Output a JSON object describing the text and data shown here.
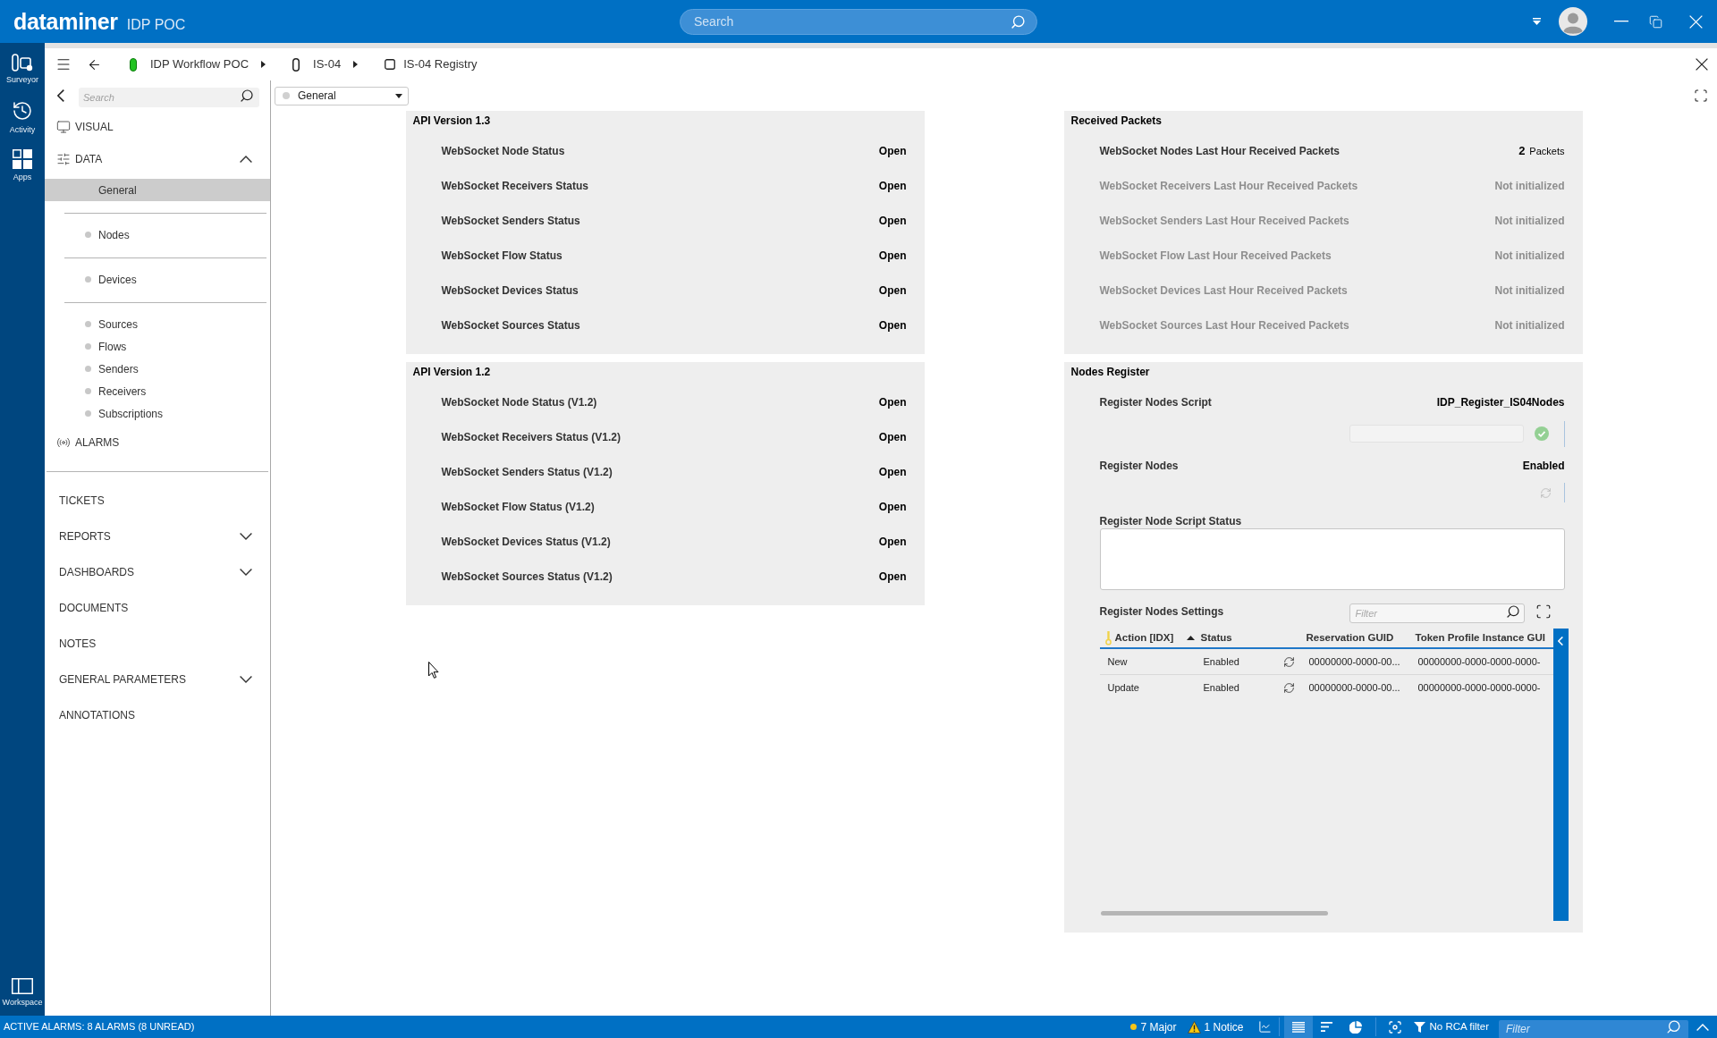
{
  "app": {
    "title": "dataminer",
    "subtitle": "IDP POC"
  },
  "header_search": {
    "placeholder": "Search"
  },
  "rail": {
    "items": [
      {
        "label": "Surveyor"
      },
      {
        "label": "Activity"
      },
      {
        "label": "Apps"
      }
    ],
    "bottom": {
      "label": "Workspace"
    }
  },
  "breadcrumb": [
    {
      "kind": "element",
      "label": "IDP Workflow POC"
    },
    {
      "kind": "protocol",
      "label": "IS-04"
    },
    {
      "kind": "page",
      "label": "IS-04 Registry"
    }
  ],
  "nav": {
    "search": {
      "placeholder": "Search"
    },
    "top": [
      {
        "label": "VISUAL"
      },
      {
        "label": "DATA",
        "expanded": true,
        "groups": [
          [
            {
              "label": "General",
              "selected": true
            }
          ],
          [
            {
              "label": "Nodes",
              "selected": false
            }
          ],
          [
            {
              "label": "Devices",
              "selected": false
            }
          ],
          [
            {
              "label": "Sources",
              "selected": false
            },
            {
              "label": "Flows",
              "selected": false
            },
            {
              "label": "Senders",
              "selected": false
            },
            {
              "label": "Receivers",
              "selected": false
            },
            {
              "label": "Subscriptions",
              "selected": false
            }
          ]
        ]
      },
      {
        "label": "ALARMS"
      }
    ],
    "bottom": [
      {
        "label": "TICKETS"
      },
      {
        "label": "REPORTS",
        "expanded": false
      },
      {
        "label": "DASHBOARDS",
        "expanded": false
      },
      {
        "label": "DOCUMENTS"
      },
      {
        "label": "NOTES"
      },
      {
        "label": "GENERAL PARAMETERS",
        "expanded": false
      },
      {
        "label": "ANNOTATIONS"
      }
    ]
  },
  "page_selector": {
    "value": "General"
  },
  "columns": [
    {
      "panels": [
        {
          "title": "API Version 1.3",
          "rows": [
            {
              "kind": "parameter",
              "label": "WebSocket Node Status",
              "value": "Open"
            },
            {
              "kind": "parameter",
              "label": "WebSocket Receivers Status",
              "value": "Open"
            },
            {
              "kind": "parameter",
              "label": "WebSocket Senders Status",
              "value": "Open"
            },
            {
              "kind": "parameter",
              "label": "WebSocket Flow Status",
              "value": "Open"
            },
            {
              "kind": "parameter",
              "label": "WebSocket Devices Status",
              "value": "Open"
            },
            {
              "kind": "parameter",
              "label": "WebSocket Sources Status",
              "value": "Open"
            }
          ]
        },
        {
          "title": "API Version 1.2",
          "rows": [
            {
              "kind": "parameter",
              "label": "WebSocket Node Status (V1.2)",
              "value": "Open"
            },
            {
              "kind": "parameter",
              "label": "WebSocket Receivers Status (V1.2)",
              "value": "Open"
            },
            {
              "kind": "parameter",
              "label": "WebSocket Senders Status (V1.2)",
              "value": "Open"
            },
            {
              "kind": "parameter",
              "label": "WebSocket Flow Status (V1.2)",
              "value": "Open"
            },
            {
              "kind": "parameter",
              "label": "WebSocket Devices Status (V1.2)",
              "value": "Open"
            },
            {
              "kind": "parameter",
              "label": "WebSocket Sources Status (V1.2)",
              "value": "Open"
            }
          ]
        }
      ]
    },
    {
      "panels": [
        {
          "title": "Received Packets",
          "rows": [
            {
              "kind": "parameter",
              "label": "WebSocket Nodes Last Hour Received Packets",
              "value": "2",
              "unit": "Packets",
              "disabled": false
            },
            {
              "kind": "parameter",
              "label": "WebSocket Receivers Last Hour Received Packets",
              "value": "Not initialized",
              "disabled": true
            },
            {
              "kind": "parameter",
              "label": "WebSocket Senders Last Hour Received Packets",
              "value": "Not initialized",
              "disabled": true
            },
            {
              "kind": "parameter",
              "label": "WebSocket Flow Last Hour Received Packets",
              "value": "Not initialized",
              "disabled": true
            },
            {
              "kind": "parameter",
              "label": "WebSocket Devices Last Hour Received Packets",
              "value": "Not initialized",
              "disabled": true
            },
            {
              "kind": "parameter",
              "label": "WebSocket Sources Last Hour Received Packets",
              "value": "Not initialized",
              "disabled": true
            }
          ]
        },
        {
          "title": "Nodes Register",
          "rows": [
            {
              "kind": "parameter",
              "label": "Register Nodes Script",
              "value": "IDP_Register_IS04Nodes"
            },
            {
              "kind": "script_field"
            },
            {
              "kind": "parameter",
              "label": "Register Nodes",
              "value": "Enabled"
            },
            {
              "kind": "refresh"
            },
            {
              "kind": "text_box",
              "label": "Register Node Script Status"
            },
            {
              "kind": "table",
              "label": "Register Nodes Settings",
              "filter": {
                "placeholder": "Filter"
              },
              "columns": [
                {
                  "kind": "text",
                  "label": "Action [IDX]",
                  "primary_key": true,
                  "sort_ascending": true
                },
                {
                  "kind": "text",
                  "label": "Status"
                },
                {
                  "kind": "button"
                },
                {
                  "kind": "text",
                  "label": "Reservation GUID"
                },
                {
                  "kind": "text",
                  "label": "Token Profile Instance GUI"
                }
              ],
              "rows": [
                {
                  "cells": [
                    "New",
                    "Enabled",
                    "",
                    "00000000-0000-00...",
                    "00000000-0000-0000-0000-"
                  ]
                },
                {
                  "cells": [
                    "Update",
                    "Enabled",
                    "",
                    "00000000-0000-00...",
                    "00000000-0000-0000-0000-"
                  ]
                }
              ]
            }
          ]
        }
      ]
    }
  ],
  "status_bar": {
    "alarms": "ACTIVE ALARMS: 8 ALARMS (8 UNREAD)",
    "counters": [
      {
        "kind": "dot",
        "label": "7 Major",
        "color": "#f5c518"
      },
      {
        "kind": "warning",
        "label": "1 Notice"
      }
    ],
    "views": [
      {
        "selected": true
      },
      {
        "selected": false
      },
      {
        "selected": false
      }
    ],
    "rca_filter": "No RCA filter",
    "filter": {
      "placeholder": "Filter"
    }
  }
}
